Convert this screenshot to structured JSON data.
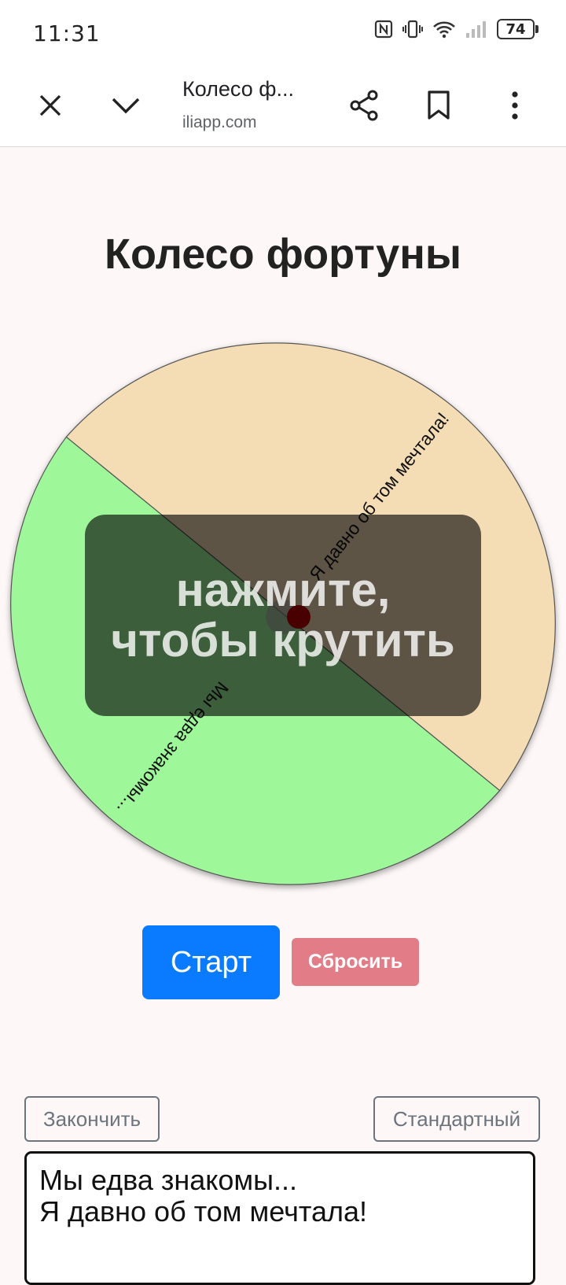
{
  "status_bar": {
    "time": "11:31",
    "battery": "74",
    "icons": [
      "nfc-icon",
      "vibrate-icon",
      "wifi-icon",
      "signal-icon",
      "battery-icon"
    ]
  },
  "browser": {
    "tab_title": "Колесо ф...",
    "url": "iliapp.com",
    "icons": [
      "close-icon",
      "chevron-down-icon",
      "share-icon",
      "bookmark-icon",
      "more-vert-icon"
    ]
  },
  "page": {
    "title": "Колесо фортуны",
    "wheel": {
      "segments": [
        {
          "label": "Я давно об том мечтала!",
          "color": "#f4ddb5"
        },
        {
          "label": "Мы едва знакомы...",
          "color": "#9ef89a"
        }
      ],
      "overlay_text": "нажмите, чтобы крутить"
    },
    "buttons": {
      "start": "Старт",
      "reset": "Сбросить",
      "finish": "Закончить",
      "standard": "Стандартный"
    },
    "textarea_value": "Мы едва знакомы...\nЯ давно об том мечтала!"
  },
  "colors": {
    "start_button": "#0a7bff",
    "reset_button": "#e27c87",
    "page_background": "#fdf7f7"
  }
}
